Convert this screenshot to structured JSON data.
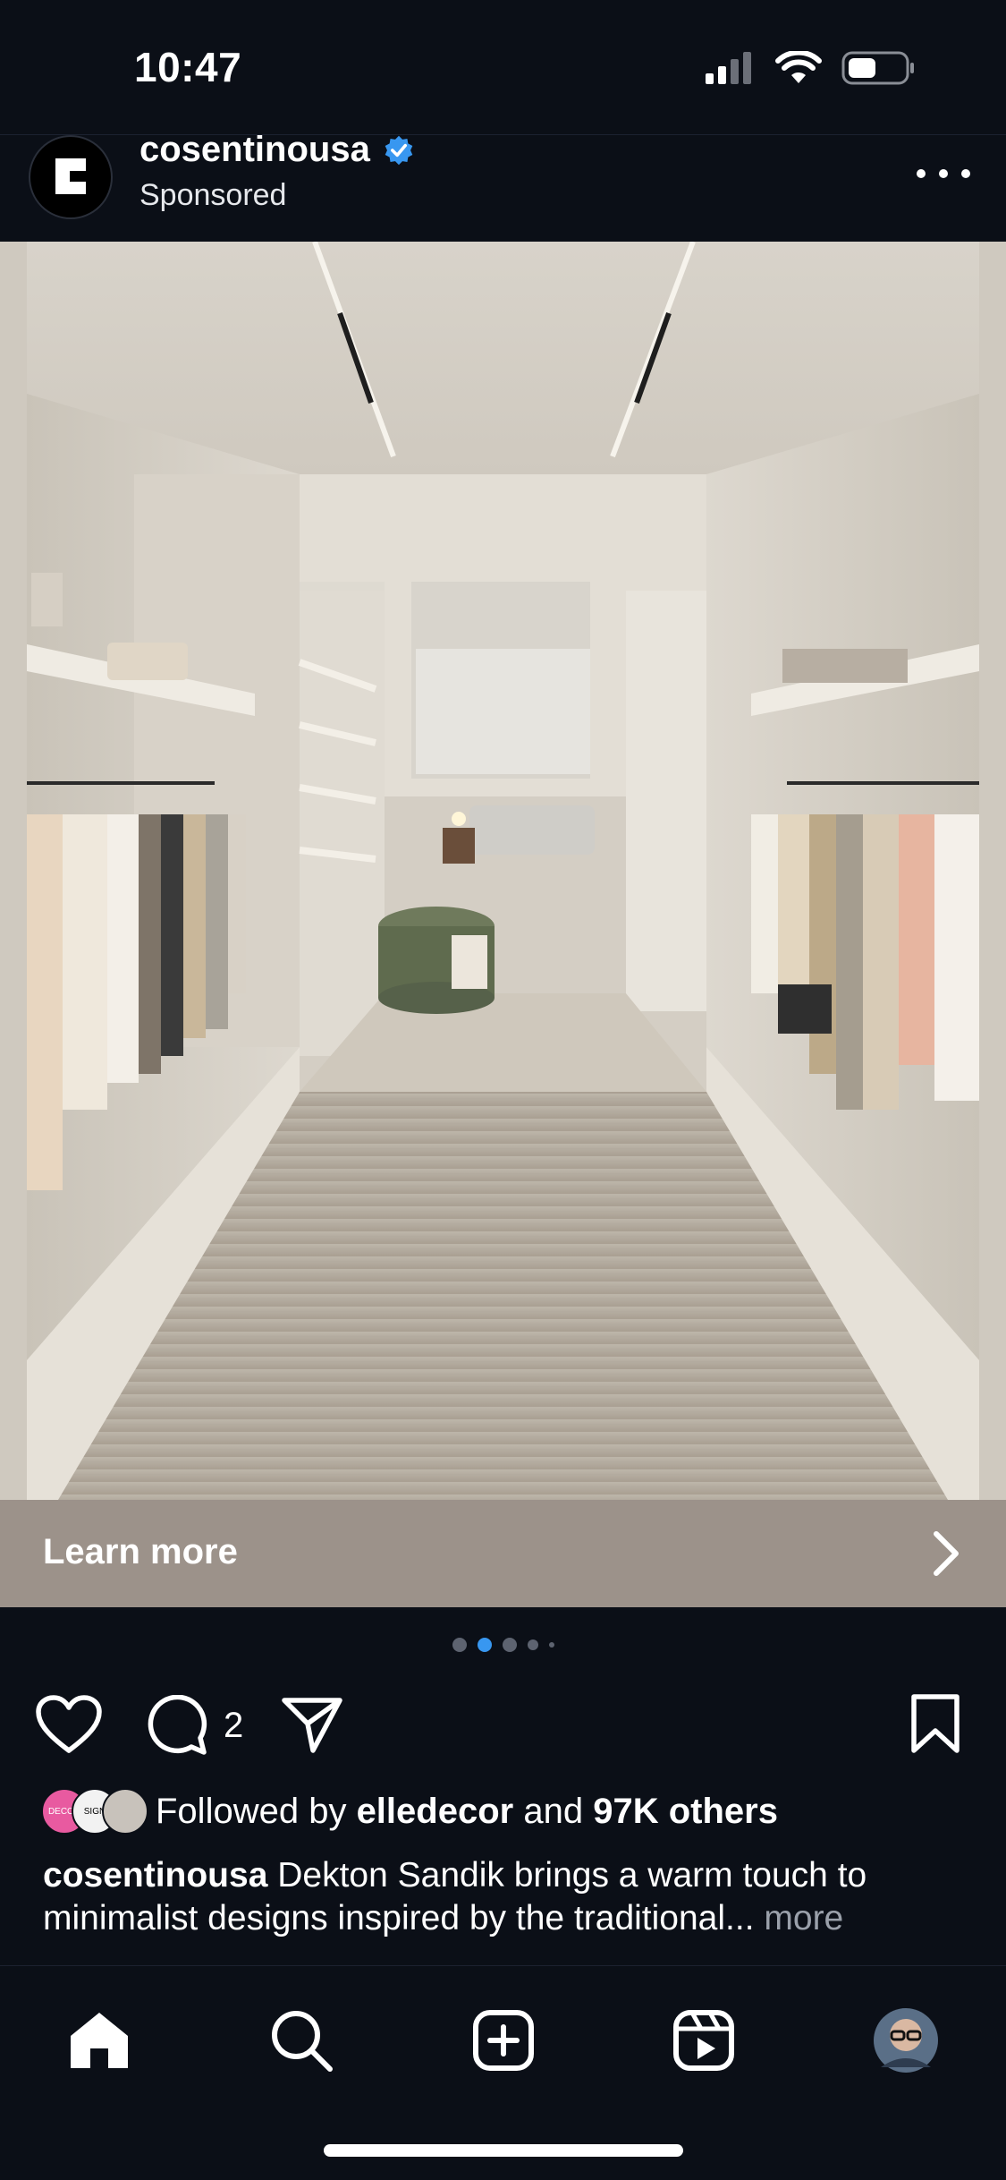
{
  "status_bar": {
    "time": "10:47"
  },
  "post": {
    "username": "cosentinousa",
    "verified": true,
    "sponsored_label": "Sponsored",
    "cta_label": "Learn more",
    "carousel": {
      "count": 5,
      "active_index": 1
    },
    "comment_count": "2",
    "followed_by": {
      "prefix": "Followed by",
      "name": "elledecor",
      "connector": "and",
      "others": "97K others"
    },
    "caption": {
      "username": "cosentinousa",
      "text": "Dekton Sandik brings a warm touch to minimalist designs inspired by the traditional...",
      "more_label": "more"
    }
  },
  "colors": {
    "background": "#0b0f17",
    "verified_badge": "#3897f0",
    "cta_bar": "#9c928a",
    "muted_text": "#9aa0aa"
  },
  "icons": {
    "header": [
      "cosentino-logo-icon",
      "verified-badge-icon",
      "more-options-icon"
    ],
    "actions": [
      "heart-icon",
      "comment-icon",
      "share-icon",
      "bookmark-icon"
    ],
    "tabs": [
      "home-icon",
      "search-icon",
      "create-post-icon",
      "reels-icon",
      "profile-avatar"
    ]
  }
}
